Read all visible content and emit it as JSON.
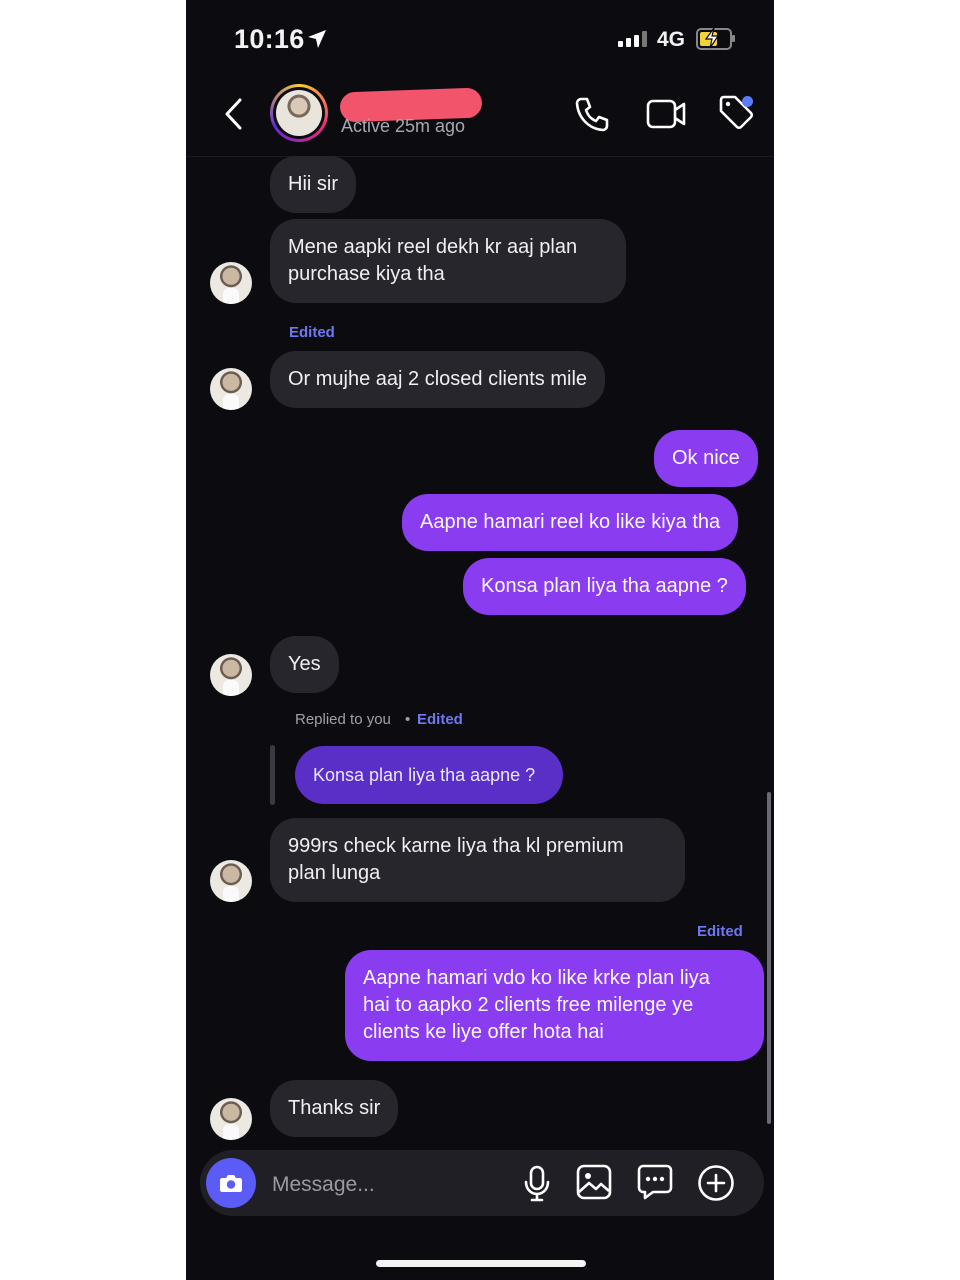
{
  "status_bar": {
    "time": "10:16",
    "network": "4G"
  },
  "header": {
    "contact_status": "Active 25m ago"
  },
  "meta": {
    "edited": "Edited",
    "replied_to": "Replied to you",
    "dot": "•"
  },
  "messages": [
    {
      "from": "them",
      "text": "Hii sir"
    },
    {
      "from": "them",
      "text": "Mene aapki reel dekh kr aaj plan\npurchase kiya tha"
    },
    {
      "from": "them",
      "text": "Or mujhe aaj 2 closed clients mile"
    },
    {
      "from": "me",
      "text": "Ok nice"
    },
    {
      "from": "me",
      "text": "Aapne hamari reel ko like kiya tha"
    },
    {
      "from": "me",
      "text": "Konsa plan liya tha aapne ?"
    },
    {
      "from": "them",
      "text": "Yes"
    },
    {
      "from": "them",
      "text": "999rs check karne liya tha kl premium\nplan lunga"
    },
    {
      "from": "me",
      "text": "Aapne hamari vdo ko like krke plan liya\nhai to aapko 2 clients free  milenge ye\nclients ke liye offer hota hai"
    },
    {
      "from": "them",
      "text": "Thanks sir"
    }
  ],
  "reply_quote": "Konsa plan liya tha aapne ?",
  "composer": {
    "placeholder": "Message..."
  },
  "colors": {
    "outgoing": "#8a3cf0",
    "incoming": "#26262c",
    "accent": "#5b5bf5",
    "edited": "#6e78f0"
  },
  "icons": [
    "location-arrow-icon",
    "signal-icon",
    "battery-icon",
    "back-icon",
    "call-icon",
    "video-icon",
    "tag-icon",
    "camera-icon",
    "mic-icon",
    "gallery-icon",
    "sticker-icon",
    "plus-icon"
  ]
}
